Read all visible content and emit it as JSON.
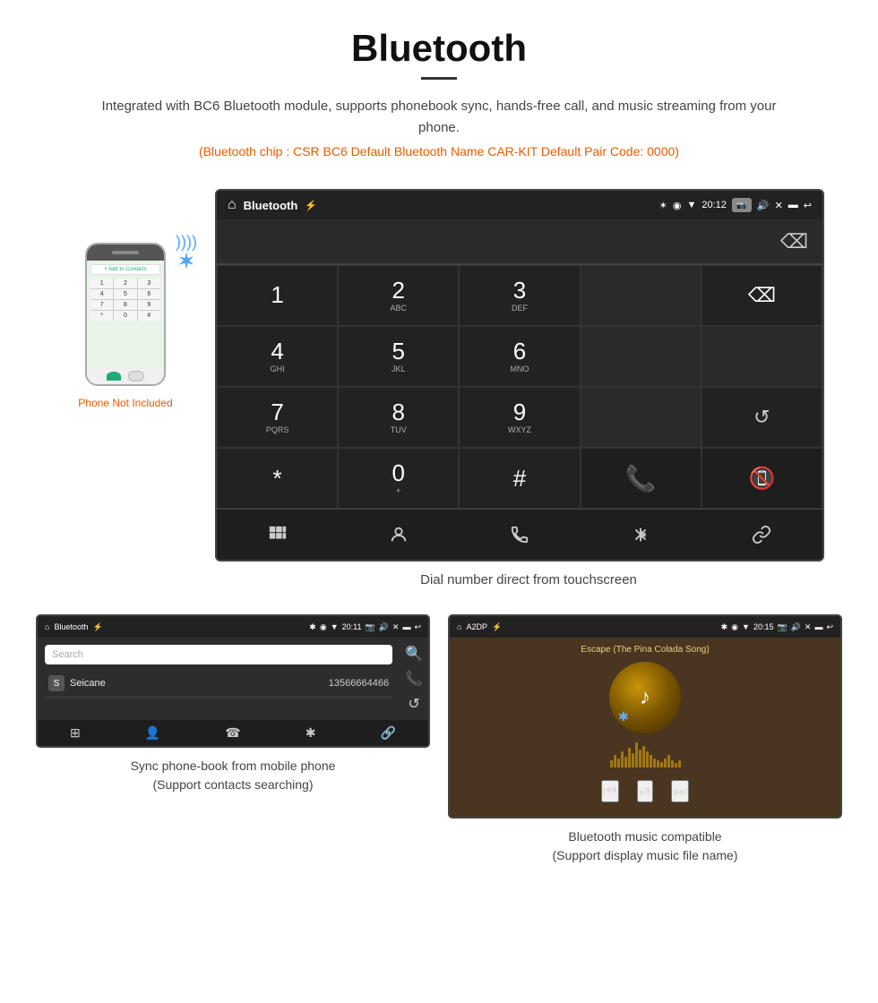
{
  "header": {
    "title": "Bluetooth",
    "description": "Integrated with BC6 Bluetooth module, supports phonebook sync, hands-free call, and music streaming from your phone.",
    "specs": "(Bluetooth chip : CSR BC6    Default Bluetooth Name CAR-KIT    Default Pair Code: 0000)"
  },
  "phone_illustration": {
    "not_included_label": "Phone Not Included",
    "keypad": [
      "1",
      "2",
      "3",
      "4",
      "5",
      "6",
      "7",
      "8",
      "9",
      "*",
      "0",
      "#"
    ]
  },
  "dial_screen": {
    "status_bar": {
      "app_name": "Bluetooth",
      "time": "20:12"
    },
    "keys": [
      {
        "digit": "1",
        "sub": ""
      },
      {
        "digit": "2",
        "sub": "ABC"
      },
      {
        "digit": "3",
        "sub": "DEF"
      },
      {
        "digit": "",
        "sub": ""
      },
      {
        "digit": "⌫",
        "sub": ""
      },
      {
        "digit": "4",
        "sub": "GHI"
      },
      {
        "digit": "5",
        "sub": "JKL"
      },
      {
        "digit": "6",
        "sub": "MNO"
      },
      {
        "digit": "",
        "sub": ""
      },
      {
        "digit": "",
        "sub": ""
      },
      {
        "digit": "7",
        "sub": "PQRS"
      },
      {
        "digit": "8",
        "sub": "TUV"
      },
      {
        "digit": "9",
        "sub": "WXYZ"
      },
      {
        "digit": "",
        "sub": ""
      },
      {
        "digit": "↺",
        "sub": ""
      },
      {
        "digit": "*",
        "sub": ""
      },
      {
        "digit": "0",
        "sub": "+"
      },
      {
        "digit": "#",
        "sub": ""
      },
      {
        "digit": "📞",
        "sub": "green"
      },
      {
        "digit": "📵",
        "sub": "red"
      }
    ],
    "bottom_nav": [
      "⊞",
      "👤",
      "☎",
      "✱",
      "🔗"
    ]
  },
  "dial_caption": "Dial number direct from touchscreen",
  "phonebook_screen": {
    "status_bar": {
      "app_name": "Bluetooth",
      "time": "20:11"
    },
    "search_placeholder": "Search",
    "contacts": [
      {
        "letter": "S",
        "name": "Seicane",
        "number": "13566664466"
      }
    ],
    "right_icons": [
      "🔍",
      "☎",
      "↺"
    ]
  },
  "music_screen": {
    "status_bar": {
      "app_name": "A2DP",
      "time": "20:15"
    },
    "song_title": "Escape (The Pina Colada Song)",
    "controls": [
      "⏮",
      "⏯",
      "⏭"
    ]
  },
  "captions": {
    "phonebook": "Sync phone-book from mobile phone\n(Support contacts searching)",
    "music": "Bluetooth music compatible\n(Support display music file name)"
  }
}
